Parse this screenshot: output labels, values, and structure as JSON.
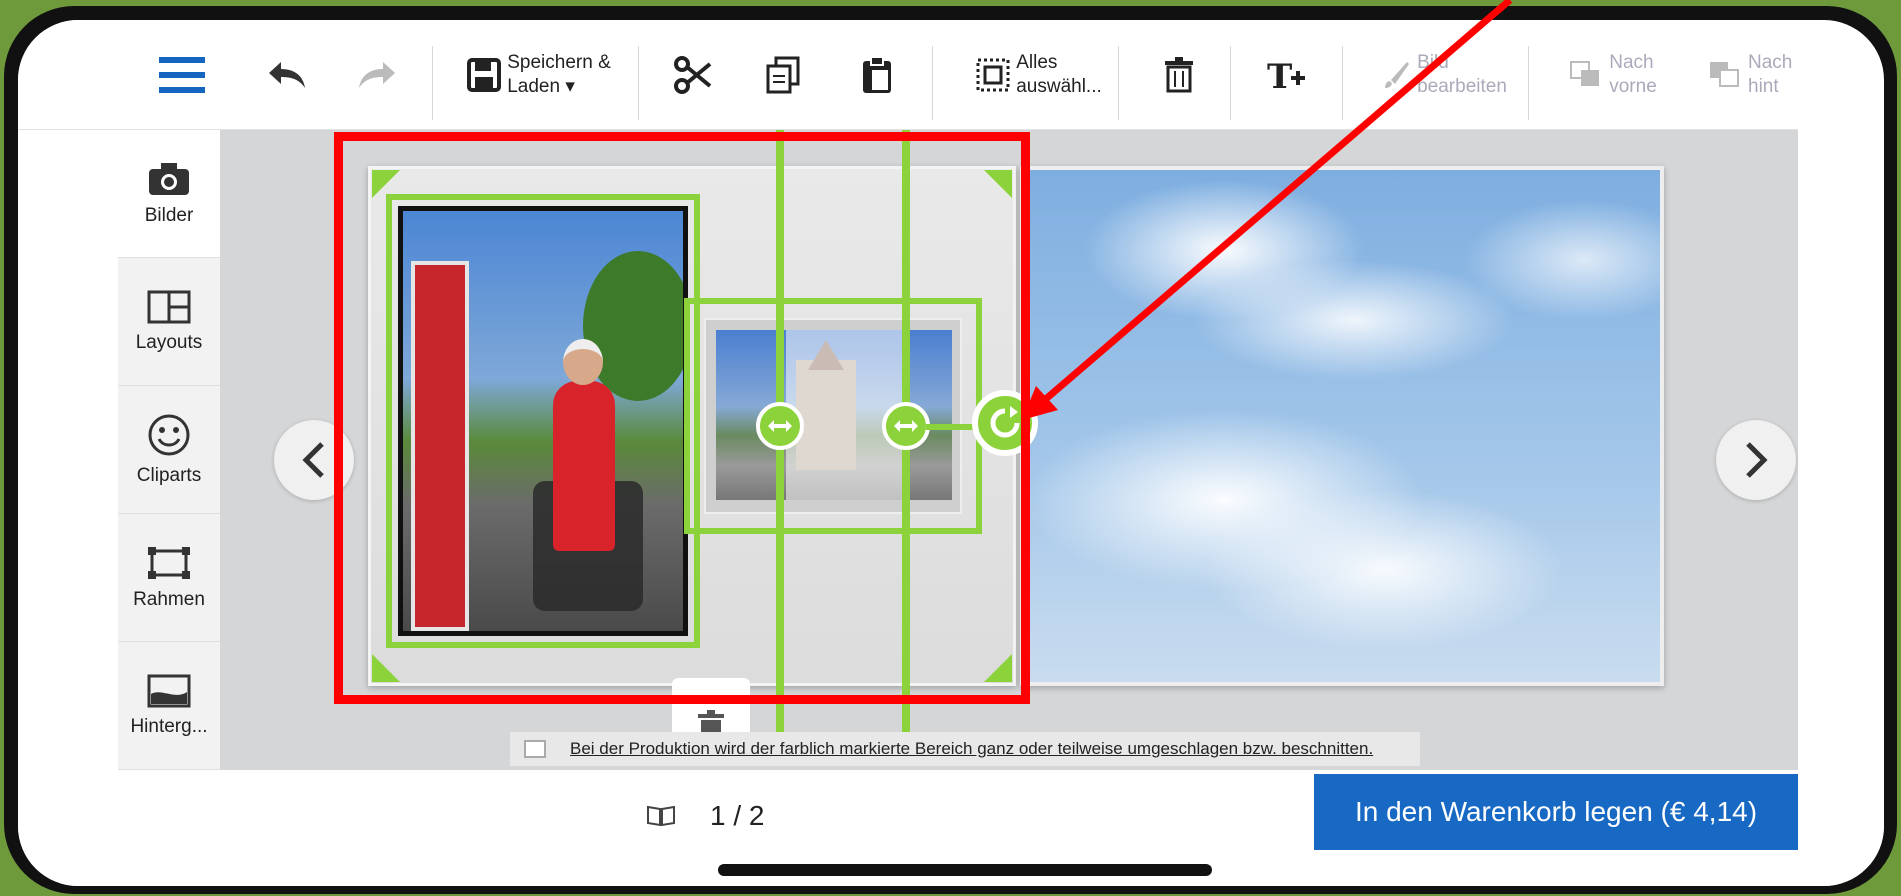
{
  "toolbar": {
    "save_label_line1": "Speichern &",
    "save_label_line2": "Laden ▾",
    "select_all_line1": "Alles",
    "select_all_line2": "auswähl...",
    "edit_image_line1": "Bild",
    "edit_image_line2": "bearbeiten",
    "front_line1": "Nach",
    "front_line2": "vorne",
    "back_line1": "Nach",
    "back_line2": "hint"
  },
  "sidebar": {
    "items": [
      {
        "label": "Bilder",
        "icon": "camera-icon"
      },
      {
        "label": "Layouts",
        "icon": "layout-icon"
      },
      {
        "label": "Cliparts",
        "icon": "smiley-icon"
      },
      {
        "label": "Rahmen",
        "icon": "frame-icon"
      },
      {
        "label": "Hinterg..."
      }
    ]
  },
  "canvas": {
    "hint_text": "Bei der Produktion wird der farblich markierte Bereich ganz oder teilweise umgeschlagen bzw. beschnitten."
  },
  "bottom": {
    "page_indicator": "1 / 2",
    "cart_button": "In den Warenkorb legen (€ 4,14)"
  },
  "colors": {
    "accent_green": "#8cd23a",
    "cart_blue": "#1769c4",
    "annotation_red": "#ff0000",
    "menu_blue": "#1565c0"
  }
}
